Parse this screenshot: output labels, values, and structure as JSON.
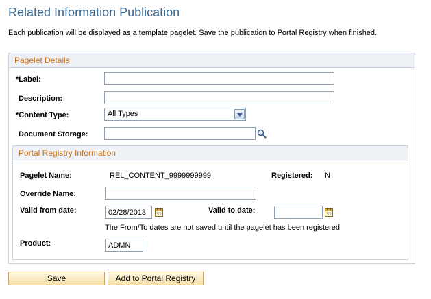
{
  "page": {
    "title": "Related Information Publication",
    "intro": "Each publication will be displayed as a template pagelet. Save the publication to Portal Registry when finished."
  },
  "pagelet_details": {
    "title": "Pagelet Details",
    "label_label": "*Label:",
    "label_value": "",
    "description_label": "Description:",
    "description_value": "",
    "content_type_label": "*Content Type:",
    "content_type_value": "All Types",
    "document_storage_label": "Document Storage:",
    "document_storage_value": ""
  },
  "portal_registry": {
    "title": "Portal Registry Information",
    "pagelet_name_label": "Pagelet Name:",
    "pagelet_name_value": "REL_CONTENT_9999999999",
    "registered_label": "Registered:",
    "registered_value": "N",
    "override_name_label": "Override Name:",
    "override_name_value": "",
    "valid_from_label": "Valid from date:",
    "valid_from_value": "02/28/2013",
    "valid_to_label": "Valid to date:",
    "valid_to_value": "",
    "dates_note": "The From/To dates are not saved until the pagelet has been registered",
    "product_label": "Product:",
    "product_value": "ADMN"
  },
  "buttons": {
    "save": "Save",
    "add_to_registry": "Add to Portal Registry"
  },
  "icons": {
    "lookup": "magnifier-icon",
    "calendar": "calendar-icon",
    "dropdown": "chevron-down-icon"
  },
  "colors": {
    "title": "#3c6891",
    "group_title": "#cf6e16",
    "group_header_bg": "#eef2f6",
    "button_bg": "#f7dfa5"
  }
}
